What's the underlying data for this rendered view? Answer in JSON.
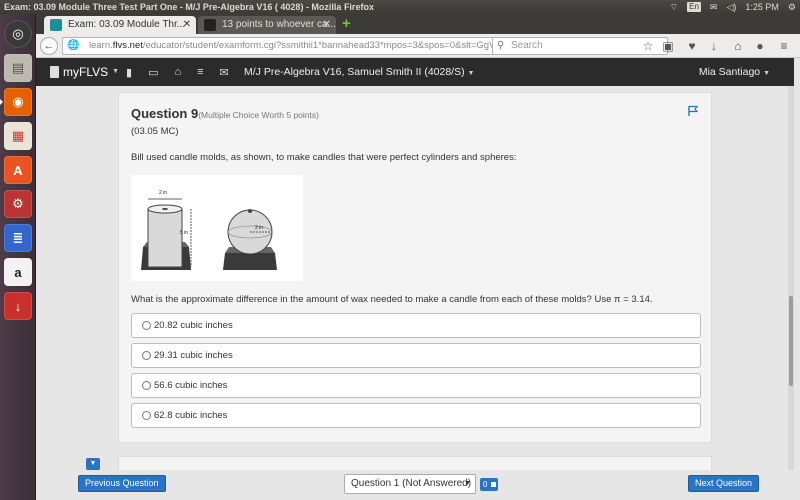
{
  "os": {
    "window_title": "Exam: 03.09 Module Three Test Part One - M/J Pre-Algebra V16 ( 4028) - Mozilla Firefox",
    "keyboard_layout": "En",
    "clock": "1:25 PM"
  },
  "browser": {
    "tabs": [
      {
        "label": "Exam: 03.09 Module Thr..."
      },
      {
        "label": "13 points to whoever ca..."
      }
    ],
    "url_prefix": "learn.",
    "url_host": "flvs.net",
    "url_rest": "/educator/student/examform.cgi?ssmithii1*bannahead33*mpos=3&spos=0&slt=GgVc",
    "search_placeholder": "Search"
  },
  "site": {
    "logo": "myFLVS",
    "course": "M/J Pre-Algebra V16, Samuel Smith II (4028/S)",
    "user": "Mia Santiago"
  },
  "question": {
    "title": "Question 9",
    "worth": "(Multiple Choice Worth 5 points)",
    "code": "(03.05 MC)",
    "prompt": "Bill used candle molds, as shown, to make candles that were perfect cylinders and spheres:",
    "figure_labels": {
      "diameter": "2 in",
      "height": "5 in",
      "radius": "2 in"
    },
    "question_text": "What is the approximate difference in the amount of wax needed to make a candle from each of these molds? Use π = 3.14.",
    "options": [
      {
        "label": "20.82 cubic inches"
      },
      {
        "label": "29.31 cubic inches"
      },
      {
        "label": "56.6 cubic inches"
      },
      {
        "label": "62.8 cubic inches"
      }
    ]
  },
  "footer": {
    "prev_label": "Previous Question",
    "select_value": "Question 1 (Not Answered)",
    "badge_count": "0",
    "next_label": "Next Question"
  },
  "colors": {
    "accent": "#2a73c5",
    "nav_dark": "#2b2b2b",
    "launcher": "#4d3c48"
  }
}
